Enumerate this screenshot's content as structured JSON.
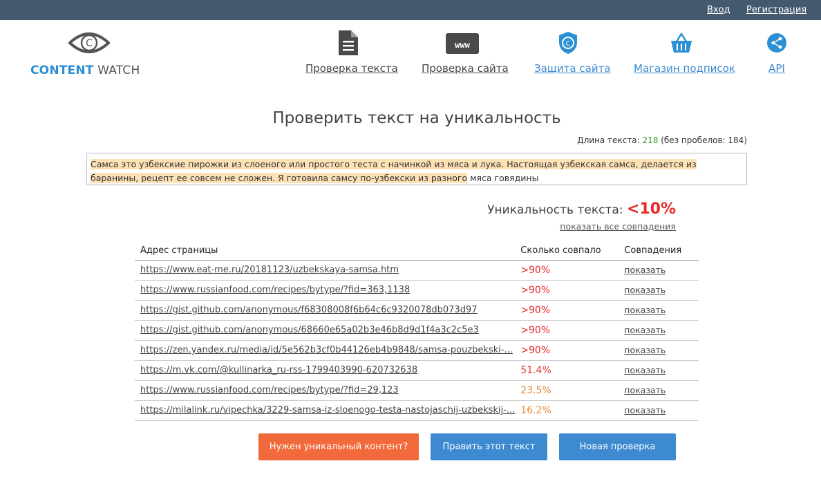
{
  "topbar": {
    "login": "Вход",
    "register": "Регистрация"
  },
  "logo": {
    "part1": "CONTENT",
    "part2": "WATCH"
  },
  "nav": [
    {
      "label": "Проверка текста",
      "icon": "document-icon"
    },
    {
      "label": "Проверка сайта",
      "icon": "www-icon",
      "icon_text": "www"
    },
    {
      "label": "Защита сайта",
      "icon": "shield-copyright-icon"
    },
    {
      "label": "Магазин подписок",
      "icon": "basket-icon"
    },
    {
      "label": "API",
      "icon": "api-share-icon"
    }
  ],
  "title": "Проверить текст на уникальность",
  "length": {
    "label": "Длина текста:",
    "count": "218",
    "nospace": "(без пробелов: 184)"
  },
  "text": {
    "highlighted": "Самса это узбекские пирожки из слоеного или простого теста с начинкой из мяса и лука. Настоящая узбекская самса, делается из баранины, рецепт ее совсем не сложен. Я готовила самсу по-узбекски из разного",
    "plain": " мяса говядины"
  },
  "uniqueness": {
    "label": "Уникальность текста:",
    "value": "<10%",
    "show_all": "показать все совпадения"
  },
  "table": {
    "headers": [
      "Адрес страницы",
      "Сколько совпало",
      "Совпадения"
    ],
    "rows": [
      {
        "url": "https://www.eat-me.ru/20181123/uzbekskaya-samsa.htm",
        "pct": ">90%",
        "action": "показать"
      },
      {
        "url": "https://www.russianfood.com/recipes/bytype/?fid=363,1138",
        "pct": ">90%",
        "action": "показать"
      },
      {
        "url": "https://gist.github.com/anonymous/f68308008f6b64c6c9320078db073d97",
        "pct": ">90%",
        "action": "показать"
      },
      {
        "url": "https://gist.github.com/anonymous/68660e65a02b3e46b8d9d1f4a3c2c5e3",
        "pct": ">90%",
        "action": "показать"
      },
      {
        "url": "https://zen.yandex.ru/media/id/5e562b3cf0b44126eb4b9848/samsa-pouzbekski-...",
        "pct": ">90%",
        "action": "показать"
      },
      {
        "url": "https://m.vk.com/@kullinarka_ru-rss-1799403990-620732638",
        "pct": "51.4%",
        "action": "показать"
      },
      {
        "url": "https://www.russianfood.com/recipes/bytype/?fid=29,123",
        "pct": "23.5%",
        "action": "показать"
      },
      {
        "url": "https://milalink.ru/vipechka/3229-samsa-iz-sloenogo-testa-nastojaschij-uzbekskij-...",
        "pct": "16.2%",
        "action": "показать"
      }
    ]
  },
  "buttons": {
    "need_content": "Нужен уникальный контент?",
    "edit_text": "Править этот текст",
    "new_check": "Новая проверка"
  },
  "colors": {
    "topbar": "#44596e",
    "brand_blue": "#2b8fd4",
    "red": "#e52b2b",
    "orange_btn": "#f26a3b",
    "blue_btn": "#3d8ad1",
    "highlight": "#fde0b4"
  }
}
